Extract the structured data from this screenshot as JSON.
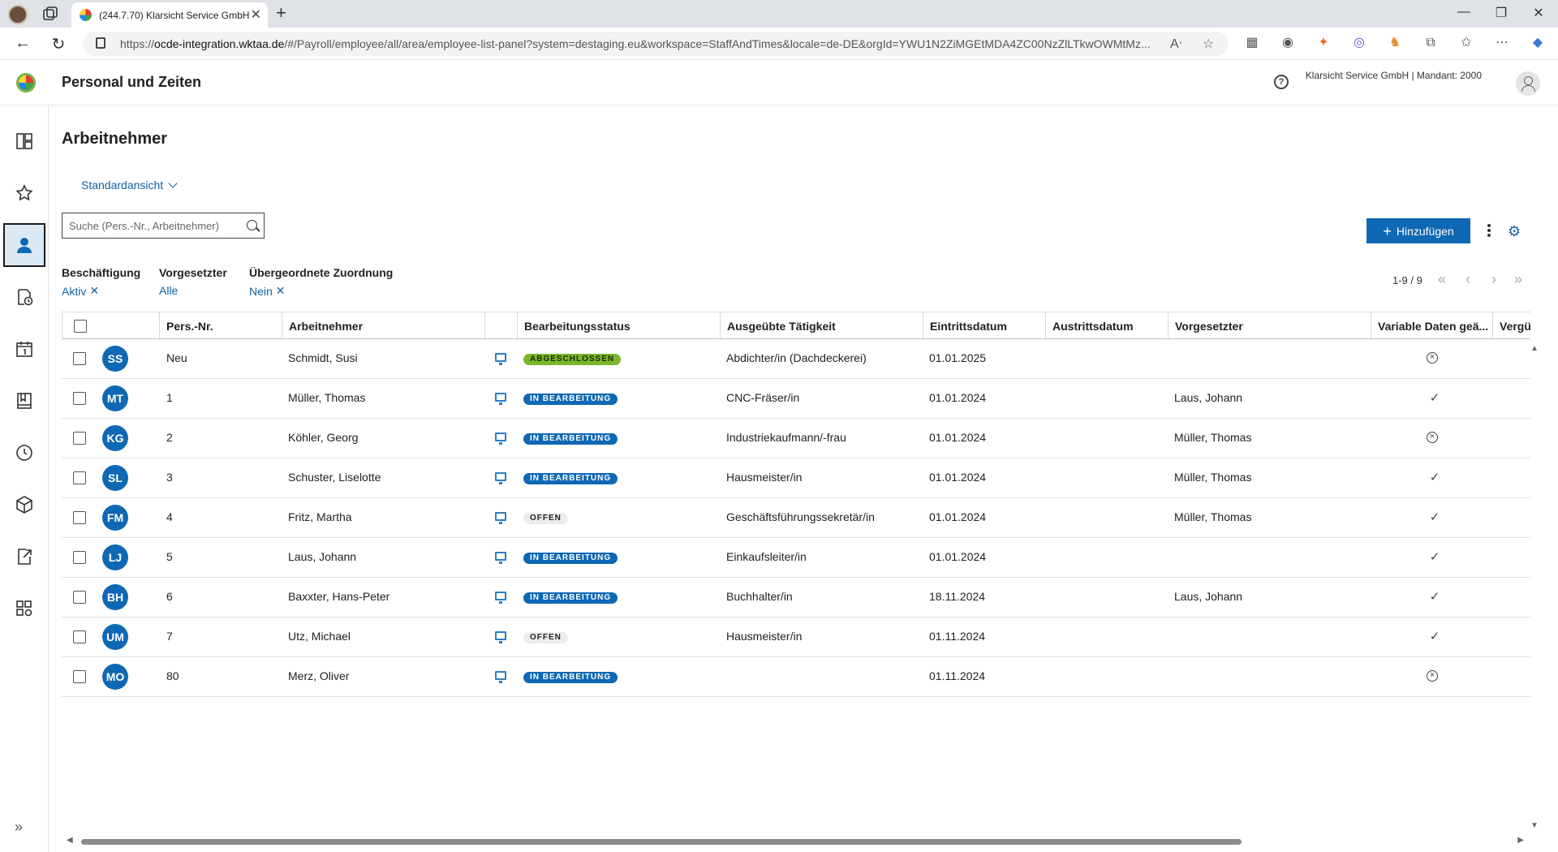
{
  "browser": {
    "tab_title": "(244.7.70) Klarsicht Service GmbH",
    "url_host": "ocde-integration.wktaa.de",
    "url_prefix": "https://",
    "url_path": "/#/Payroll/employee/all/area/employee-list-panel?system=destaging.eu&workspace=StaffAndTimes&locale=de-DE&orgId=YWU1N2ZiMGEtMDA4ZC00NzZlLTkwOWMtMz..."
  },
  "app": {
    "title": "Personal und Zeiten",
    "tenant": "Klarsicht Service GmbH | Mandant: 2000"
  },
  "page": {
    "title": "Arbeitnehmer",
    "view": "Standardansicht",
    "search_placeholder": "Suche (Pers.-Nr., Arbeitnehmer)",
    "add_label": "Hinzufügen"
  },
  "filters": [
    {
      "label": "Beschäftigung",
      "value": "Aktiv",
      "removable": true
    },
    {
      "label": "Vorgesetzter",
      "value": "Alle",
      "removable": false
    },
    {
      "label": "Übergeordnete Zuordnung",
      "value": "Nein",
      "removable": true
    }
  ],
  "pager": {
    "range": "1-9 / 9"
  },
  "columns": [
    "Pers.-Nr.",
    "Arbeitnehmer",
    "Bearbeitungsstatus",
    "Ausgeübte Tätigkeit",
    "Eintrittsdatum",
    "Austrittsdatum",
    "Vorgesetzter",
    "Variable Daten geä...",
    "Vergüt"
  ],
  "rows": [
    {
      "initials": "SS",
      "nr": "Neu",
      "name": "Schmidt, Susi",
      "status": "ABGESCHLOSSEN",
      "status_type": "done",
      "job": "Abdichter/in (Dachdeckerei)",
      "entry": "01.01.2025",
      "exit": "",
      "manager": "",
      "variable": "no"
    },
    {
      "initials": "MT",
      "nr": "1",
      "name": "Müller, Thomas",
      "status": "IN BEARBEITUNG",
      "status_type": "prog",
      "job": "CNC-Fräser/in",
      "entry": "01.01.2024",
      "exit": "",
      "manager": "Laus, Johann",
      "variable": "yes"
    },
    {
      "initials": "KG",
      "nr": "2",
      "name": "Köhler, Georg",
      "status": "IN BEARBEITUNG",
      "status_type": "prog",
      "job": "Industriekaufmann/-frau",
      "entry": "01.01.2024",
      "exit": "",
      "manager": "Müller, Thomas",
      "variable": "no"
    },
    {
      "initials": "SL",
      "nr": "3",
      "name": "Schuster, Liselotte",
      "status": "IN BEARBEITUNG",
      "status_type": "prog",
      "job": "Hausmeister/in",
      "entry": "01.01.2024",
      "exit": "",
      "manager": "Müller, Thomas",
      "variable": "yes"
    },
    {
      "initials": "FM",
      "nr": "4",
      "name": "Fritz, Martha",
      "status": "OFFEN",
      "status_type": "open",
      "job": "Geschäftsführungssekretär/in",
      "entry": "01.01.2024",
      "exit": "",
      "manager": "Müller, Thomas",
      "variable": "yes"
    },
    {
      "initials": "LJ",
      "nr": "5",
      "name": "Laus, Johann",
      "status": "IN BEARBEITUNG",
      "status_type": "prog",
      "job": "Einkaufsleiter/in",
      "entry": "01.01.2024",
      "exit": "",
      "manager": "",
      "variable": "yes"
    },
    {
      "initials": "BH",
      "nr": "6",
      "name": "Baxxter, Hans-Peter",
      "status": "IN BEARBEITUNG",
      "status_type": "prog",
      "job": "Buchhalter/in",
      "entry": "18.11.2024",
      "exit": "",
      "manager": "Laus, Johann",
      "variable": "yes"
    },
    {
      "initials": "UM",
      "nr": "7",
      "name": "Utz, Michael",
      "status": "OFFEN",
      "status_type": "open",
      "job": "Hausmeister/in",
      "entry": "01.11.2024",
      "exit": "",
      "manager": "",
      "variable": "yes"
    },
    {
      "initials": "MO",
      "nr": "80",
      "name": "Merz, Oliver",
      "status": "IN BEARBEITUNG",
      "status_type": "prog",
      "job": "",
      "entry": "01.11.2024",
      "exit": "",
      "manager": "",
      "variable": "no"
    }
  ],
  "colors": {
    "accent": "#0f68b4",
    "done": "#7bb72a",
    "link": "#14609e"
  }
}
